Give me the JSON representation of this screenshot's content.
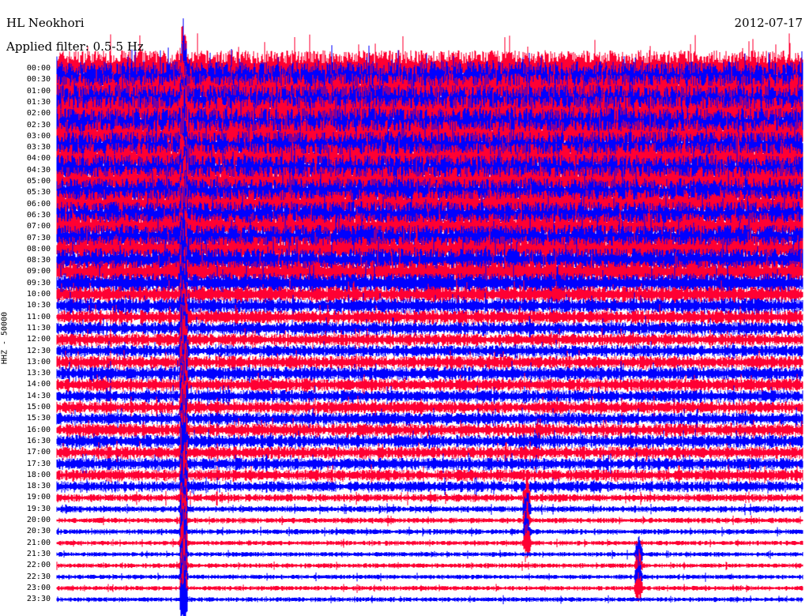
{
  "station": "HL Neokhori",
  "date": "2012-07-17",
  "filter_label": "Applied filter: 0.5-5 Hz",
  "channel_label": "HHZ - 50000",
  "colors": {
    "trace_a": "#0000ff",
    "trace_b": "#ff0033",
    "background": "#ffffff",
    "text": "#000000"
  },
  "chart_data": {
    "type": "line",
    "title": "HL Neokhori",
    "date": "2012-07-17",
    "ylabel": "HHZ - 50000",
    "xlabel": "",
    "minutes_per_line": 30,
    "row_labels": [
      "00:00",
      "00:30",
      "01:00",
      "01:30",
      "02:00",
      "02:30",
      "03:00",
      "03:30",
      "04:00",
      "04:30",
      "05:00",
      "05:30",
      "06:00",
      "06:30",
      "07:00",
      "07:30",
      "08:00",
      "08:30",
      "09:00",
      "09:30",
      "10:00",
      "10:30",
      "11:00",
      "11:30",
      "12:00",
      "12:30",
      "13:00",
      "13:30",
      "14:00",
      "14:30",
      "15:00",
      "15:30",
      "16:00",
      "16:30",
      "17:00",
      "17:30",
      "18:00",
      "18:30",
      "19:00",
      "19:30",
      "20:00",
      "20:30",
      "21:00",
      "21:30",
      "22:00",
      "22:30",
      "23:00",
      "23:30"
    ],
    "series": [
      {
        "color": "#ff0033",
        "relative_amplitude": [
          2.4,
          2.4,
          2.3,
          2.3,
          2.3,
          2.2,
          2.2,
          2.1,
          2.1,
          2.0,
          2.0,
          1.9,
          1.9,
          1.8,
          1.8,
          1.7,
          1.7,
          1.6,
          1.5,
          1.3,
          1.1,
          1.0,
          0.9,
          0.85,
          0.8,
          0.8,
          0.85,
          0.9,
          0.85,
          0.8,
          0.8,
          0.8,
          0.85,
          0.85,
          0.8,
          0.8,
          0.75,
          0.7,
          0.5,
          0.4,
          0.35,
          0.35,
          0.3,
          0.3,
          0.3,
          0.3,
          0.3,
          0.3
        ]
      },
      {
        "color": "#0000ff",
        "relative_amplitude": [
          2.4,
          2.4,
          2.3,
          2.3,
          2.3,
          2.2,
          2.2,
          2.1,
          2.1,
          2.0,
          2.0,
          1.9,
          1.9,
          1.8,
          1.8,
          1.7,
          1.7,
          1.6,
          1.5,
          1.3,
          1.1,
          1.0,
          0.9,
          0.85,
          0.8,
          0.8,
          0.85,
          0.9,
          0.85,
          0.8,
          0.8,
          0.8,
          0.85,
          0.85,
          0.8,
          0.8,
          0.75,
          0.7,
          0.5,
          0.4,
          0.35,
          0.35,
          0.3,
          0.3,
          0.3,
          0.3,
          0.3,
          0.3
        ]
      }
    ],
    "events": [
      {
        "minute_fraction": 0.17,
        "row_range": [
          0,
          47
        ],
        "relative_amplitude": 3.0
      },
      {
        "minute_fraction": 0.63,
        "row_range": [
          38,
          42
        ],
        "relative_amplitude": 1.5
      },
      {
        "minute_fraction": 0.78,
        "row_range": [
          43,
          46
        ],
        "relative_amplitude": 1.4
      }
    ]
  }
}
